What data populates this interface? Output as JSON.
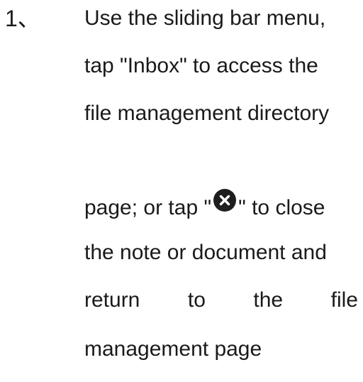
{
  "step": {
    "number": "1、",
    "lines": [
      "Use the sliding bar menu,",
      "tap \"Inbox\" to access the",
      "file management directory"
    ],
    "line4": {
      "before": "page; or tap \"",
      "icon": "close-circle-icon",
      "after": "\" to close"
    },
    "line5": "the note or document and",
    "line6_words": [
      "return",
      "to",
      "the",
      "file"
    ],
    "line7": "management page"
  },
  "colors": {
    "text": "#1a1a1a",
    "icon_fill": "#1e1e1e",
    "icon_glyph": "#ffffff"
  }
}
